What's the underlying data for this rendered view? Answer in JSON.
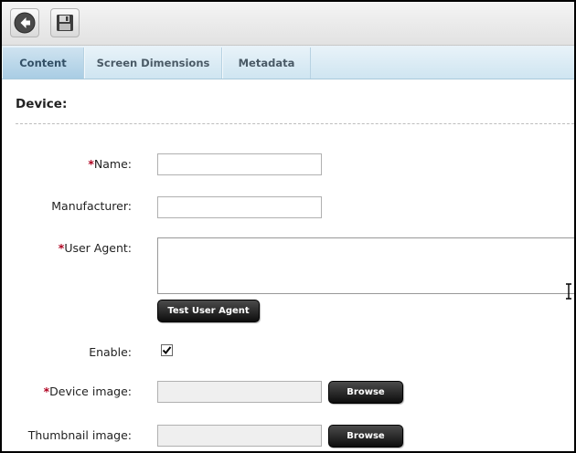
{
  "toolbar": {
    "back_icon": "back-arrow-icon",
    "save_icon": "floppy-disk-icon"
  },
  "tabs": [
    {
      "label": "Content",
      "active": true
    },
    {
      "label": "Screen Dimensions",
      "active": false
    },
    {
      "label": "Metadata",
      "active": false
    }
  ],
  "section": {
    "title": "Device:"
  },
  "form": {
    "required_marker": "*",
    "name_label": "Name:",
    "name_value": "",
    "manufacturer_label": "Manufacturer:",
    "manufacturer_value": "",
    "user_agent_label": "User Agent:",
    "user_agent_value": "",
    "test_user_agent_button": "Test User Agent",
    "enable_label": "Enable:",
    "enable_checked": true,
    "device_image_label": "Device image:",
    "device_image_value": "",
    "thumbnail_image_label": "Thumbnail image:",
    "thumbnail_image_value": "",
    "browse_button": "Browse"
  }
}
